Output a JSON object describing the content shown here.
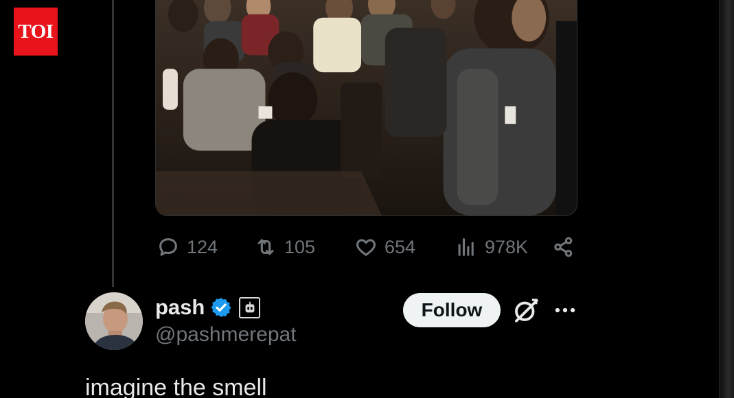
{
  "watermark": {
    "label": "TOI",
    "color": "#e8131b"
  },
  "media": {
    "description_icon": "photo-crowd-seated"
  },
  "actions": {
    "replies": {
      "icon": "reply-icon",
      "count": "124"
    },
    "reposts": {
      "icon": "repost-icon",
      "count": "105"
    },
    "likes": {
      "icon": "heart-icon",
      "count": "654"
    },
    "views": {
      "icon": "analytics-icon",
      "count": "978K"
    },
    "share": {
      "icon": "share-icon"
    }
  },
  "reply": {
    "display_name": "pash",
    "handle": "@pashmerepat",
    "verified": true,
    "verified_color": "#1d9bf0",
    "follow_label": "Follow",
    "text": "imagine the smell"
  }
}
